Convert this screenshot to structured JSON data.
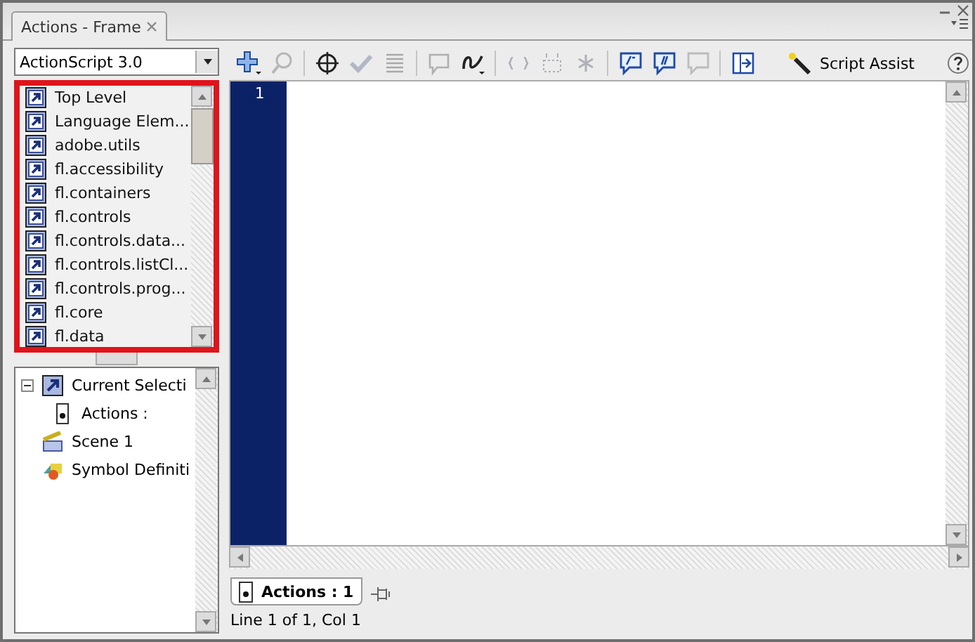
{
  "window": {
    "tab_title": "Actions - Frame"
  },
  "language_select": {
    "value": "ActionScript 3.0"
  },
  "library_list": {
    "highlighted": true,
    "items": [
      "Top Level",
      "Language Elem...",
      "adobe.utils",
      "fl.accessibility",
      "fl.containers",
      "fl.controls",
      "fl.controls.data...",
      "fl.controls.listCl...",
      "fl.controls.prog...",
      "fl.core",
      "fl.data"
    ]
  },
  "script_navigator": {
    "items": [
      {
        "label": "Current Selecti",
        "kind": "selection",
        "expanded": true,
        "children": [
          {
            "label": "Actions :",
            "kind": "frame"
          }
        ]
      },
      {
        "label": "Scene 1",
        "kind": "scene"
      },
      {
        "label": "Symbol Definiti",
        "kind": "symbols"
      }
    ]
  },
  "toolbar": {
    "items": [
      {
        "kind": "add",
        "disabled": false
      },
      {
        "kind": "find",
        "disabled": true
      },
      {
        "kind": "separator"
      },
      {
        "kind": "target",
        "disabled": false
      },
      {
        "kind": "check",
        "disabled": true
      },
      {
        "kind": "format",
        "disabled": true
      },
      {
        "kind": "separator"
      },
      {
        "kind": "hint",
        "disabled": true
      },
      {
        "kind": "debug",
        "disabled": false
      },
      {
        "kind": "separator"
      },
      {
        "kind": "braces",
        "disabled": true
      },
      {
        "kind": "box",
        "disabled": true
      },
      {
        "kind": "star",
        "disabled": true
      },
      {
        "kind": "separator"
      },
      {
        "kind": "block_comment",
        "disabled": false
      },
      {
        "kind": "line_comment",
        "disabled": false
      },
      {
        "kind": "uncomment",
        "disabled": true
      },
      {
        "kind": "separator"
      },
      {
        "kind": "toolbox",
        "disabled": false
      }
    ],
    "script_assist": {
      "label": "Script Assist",
      "on": false
    }
  },
  "editor": {
    "line_numbers": [
      "1"
    ]
  },
  "script_tabs": [
    {
      "label": "Actions : 1",
      "selected": true
    }
  ],
  "status_bar": {
    "text": "Line 1 of 1, Col 1"
  }
}
